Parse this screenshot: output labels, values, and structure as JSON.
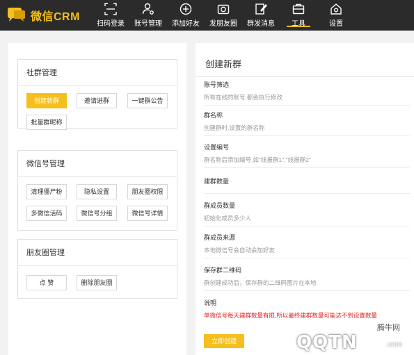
{
  "app": {
    "logo_text": "微信CRM"
  },
  "nav": [
    {
      "label": "扫码登录",
      "icon": "qr-scan-icon"
    },
    {
      "label": "账号管理",
      "icon": "user-settings-icon"
    },
    {
      "label": "添加好友",
      "icon": "add-friend-icon"
    },
    {
      "label": "发朋友圈",
      "icon": "camera-icon"
    },
    {
      "label": "群发消息",
      "icon": "edit-message-icon"
    },
    {
      "label": "工具",
      "icon": "toolbox-icon",
      "active": true
    },
    {
      "label": "设置",
      "icon": "settings-house-icon"
    }
  ],
  "left": {
    "community": {
      "title": "社群管理",
      "buttons": [
        "创建新群",
        "邀请进群",
        "一键群公告",
        "批量群昵称"
      ]
    },
    "wechat": {
      "title": "微信号管理",
      "buttons": [
        "清理僵尸粉",
        "隐私设置",
        "朋友圈权限",
        "多微信活码",
        "微信号分组",
        "微信号详情"
      ]
    },
    "moments": {
      "title": "朋友圈管理",
      "buttons": [
        "点 赞",
        "删除朋友圈"
      ]
    }
  },
  "right": {
    "title": "创建新群",
    "fields": [
      {
        "label": "账号筛选",
        "desc": "所有在线的账号,都会执行修改"
      },
      {
        "label": "群名称",
        "desc": "创建群时,设置的群名称"
      },
      {
        "label": "设置编号",
        "desc": "群名称后添加编号,如\"线报群1\",\"线报群2\""
      },
      {
        "label": "建群数量",
        "desc": ""
      },
      {
        "label": "群成员数量",
        "desc": "初始化成员多少人"
      },
      {
        "label": "群成员来源",
        "desc": "本地微信号会自动会加好友"
      },
      {
        "label": "保存群二维码",
        "desc": "群创建成功后，保存群的二维码图片在本地"
      },
      {
        "label": "说明",
        "desc": "单微信号每天建群数量有限,所以最终建群数量可能达不到设置数量"
      }
    ],
    "create_button": "立即创建"
  },
  "watermark": {
    "top": "腾牛网",
    "main": "QQTN",
    "suffix": ".com"
  },
  "colors": {
    "accent": "#f5bf1e",
    "topbar": "#2b2b2b",
    "warning": "#e02020"
  }
}
